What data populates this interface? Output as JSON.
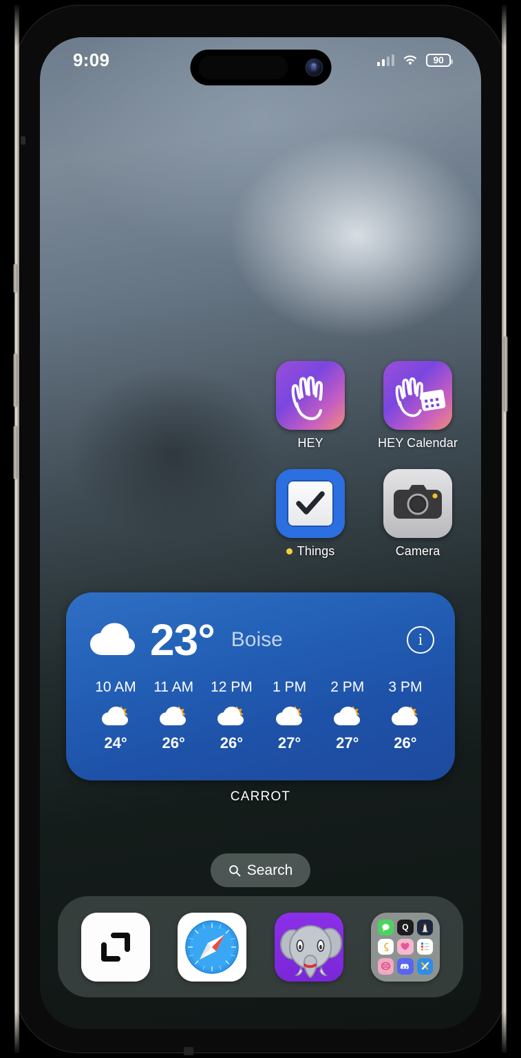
{
  "device": {
    "model": "iphone-15-pro"
  },
  "status_bar": {
    "time": "9:09",
    "battery_percent": "90",
    "cellular_icon": "cellular-signal-icon",
    "wifi_icon": "wifi-icon",
    "battery_icon": "battery-icon"
  },
  "home_screen": {
    "app_rows": [
      {
        "apps": [
          {
            "label": "HEY",
            "icon": "hey-app-icon",
            "badge_dot": false
          },
          {
            "label": "HEY Calendar",
            "icon": "hey-calendar-app-icon",
            "badge_dot": false
          }
        ]
      },
      {
        "apps": [
          {
            "label": "Things",
            "icon": "things-app-icon",
            "badge_dot": true
          },
          {
            "label": "Camera",
            "icon": "camera-app-icon",
            "badge_dot": false
          }
        ]
      }
    ],
    "widget": {
      "name": "CARROT",
      "condition_icon": "cloud-icon",
      "temperature": "23°",
      "location": "Boise",
      "info_button": "i",
      "hours": [
        {
          "time": "10 AM",
          "icon": "partly-cloudy-icon",
          "temp": "24°"
        },
        {
          "time": "11 AM",
          "icon": "partly-cloudy-icon",
          "temp": "26°"
        },
        {
          "time": "12 PM",
          "icon": "partly-cloudy-icon",
          "temp": "26°"
        },
        {
          "time": "1 PM",
          "icon": "partly-cloudy-icon",
          "temp": "27°"
        },
        {
          "time": "2 PM",
          "icon": "partly-cloudy-icon",
          "temp": "27°"
        },
        {
          "time": "3 PM",
          "icon": "partly-cloudy-icon",
          "temp": "26°"
        }
      ],
      "accent_color": "#2462b8"
    },
    "search": {
      "label": "Search",
      "icon": "search-icon"
    },
    "dock": {
      "items": [
        {
          "name": "tot-app-icon",
          "label": ""
        },
        {
          "name": "safari-app-icon",
          "label": ""
        },
        {
          "name": "ivory-mastodon-app-icon",
          "label": ""
        },
        {
          "name": "app-folder-icon",
          "label": ""
        }
      ],
      "folder_minis": [
        "messages-icon",
        "quill-icon",
        "lighthouse-icon",
        "script-icon",
        "heart-icon",
        "reminders-icon",
        "pink-app-icon",
        "discord-icon",
        "tools-icon"
      ]
    }
  }
}
